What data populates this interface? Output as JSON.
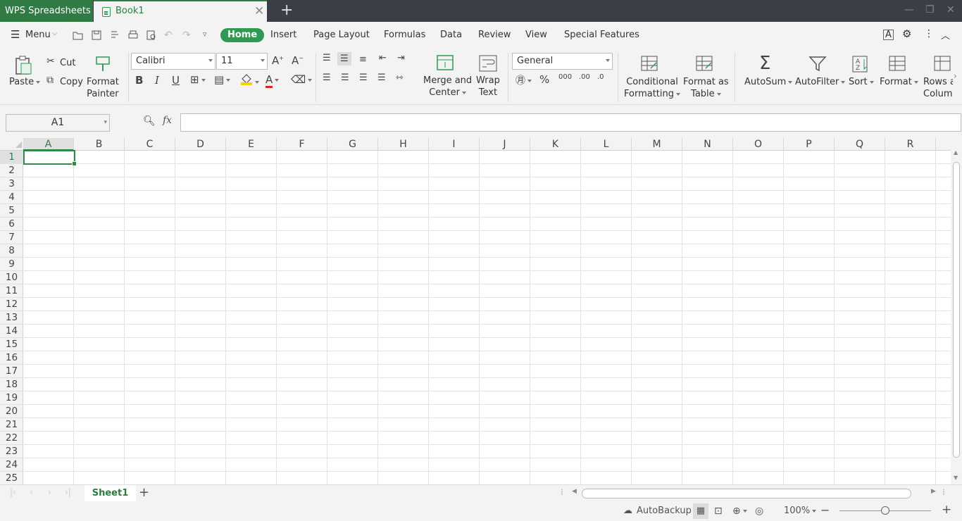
{
  "app": {
    "title": "WPS Spreadsheets"
  },
  "doc_tab": {
    "name": "Book1"
  },
  "menu": {
    "label": "Menu"
  },
  "tabs": [
    "Home",
    "Insert",
    "Page Layout",
    "Formulas",
    "Data",
    "Review",
    "View",
    "Special Features"
  ],
  "ribbon": {
    "paste": "Paste",
    "cut": "Cut",
    "copy": "Copy",
    "format_painter_1": "Format",
    "format_painter_2": "Painter",
    "font_name": "Calibri",
    "font_size": "11",
    "merge_1": "Merge and",
    "merge_2": "Center",
    "wrap_1": "Wrap",
    "wrap_2": "Text",
    "number_format": "General",
    "cond_1": "Conditional",
    "cond_2": "Formatting",
    "fat_1": "Format as",
    "fat_2": "Table",
    "autosum": "AutoSum",
    "autofilter": "AutoFilter",
    "sort": "Sort",
    "format": "Format",
    "rows_1": "Rows a",
    "rows_2": "Columi"
  },
  "formula_bar": {
    "name_box": "A1",
    "fx": "fx",
    "content": ""
  },
  "columns": [
    "A",
    "B",
    "C",
    "D",
    "E",
    "F",
    "G",
    "H",
    "I",
    "J",
    "K",
    "L",
    "M",
    "N",
    "O",
    "P",
    "Q",
    "R"
  ],
  "rows": [
    "1",
    "2",
    "3",
    "4",
    "5",
    "6",
    "7",
    "8",
    "9",
    "10",
    "11",
    "12",
    "13",
    "14",
    "15",
    "16",
    "17",
    "18",
    "19",
    "20",
    "21",
    "22",
    "23",
    "24",
    "25"
  ],
  "sheets": [
    "Sheet1"
  ],
  "status": {
    "autobackup": "AutoBackup",
    "zoom": "100%"
  },
  "colors": {
    "accent": "#2f9a51",
    "titlebar": "#3b3e47",
    "app_tab": "#2f7b43"
  }
}
